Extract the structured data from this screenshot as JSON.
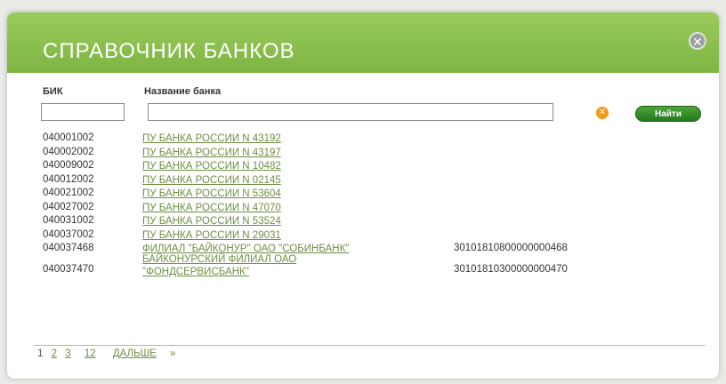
{
  "dialog": {
    "title": "СПРАВОЧНИК БАНКОВ",
    "close_symbol": "✕"
  },
  "filters": {
    "bik_label": "БИК",
    "bik_value": "",
    "name_label": "Название банка",
    "name_value": "",
    "clear_symbol": "✕",
    "find_label": "Найти"
  },
  "rows": [
    {
      "bik": "040001002",
      "name": "ПУ БАНКА РОССИИ N 43192",
      "account": ""
    },
    {
      "bik": "040002002",
      "name": "ПУ БАНКА РОССИИ N 43197",
      "account": ""
    },
    {
      "bik": "040009002",
      "name": "ПУ БАНКА РОССИИ N 10482",
      "account": ""
    },
    {
      "bik": "040012002",
      "name": "ПУ БАНКА РОССИИ N 02145",
      "account": ""
    },
    {
      "bik": "040021002",
      "name": "ПУ БАНКА РОССИИ N 53604",
      "account": ""
    },
    {
      "bik": "040027002",
      "name": "ПУ БАНКА РОССИИ N 47070",
      "account": ""
    },
    {
      "bik": "040031002",
      "name": "ПУ БАНКА РОССИИ N 53524",
      "account": ""
    },
    {
      "bik": "040037002",
      "name": "ПУ БАНКА РОССИИ N 29031",
      "account": ""
    },
    {
      "bik": "040037468",
      "name": "ФИЛИАЛ \"БАЙКОНУР\" ОАО \"СОБИНБАНК\"",
      "account": "30101810800000000468"
    },
    {
      "bik": "040037470",
      "name": "БАЙКОНУРСКИЙ ФИЛИАЛ ОАО \"ФОНДСЕРВИСБАНК\"",
      "account": "30101810300000000470"
    }
  ],
  "pager": {
    "current": "1",
    "pages": [
      "2",
      "3",
      "12"
    ],
    "next_label": "ДАЛЬШЕ",
    "last_label": "»"
  },
  "colors": {
    "header": "#8cc152",
    "link": "#6f8e44",
    "find_button": "#2f8a27"
  }
}
